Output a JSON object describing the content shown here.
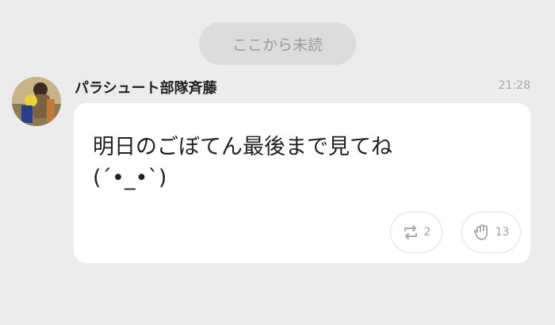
{
  "divider": {
    "unread_label": "ここから未読"
  },
  "message": {
    "sender_name": "パラシュート部隊斉藤",
    "time": "21:28",
    "text": "明日のごぼてん最後まで見てね\n(´•_•`)",
    "reactions": [
      {
        "icon": "repost-icon",
        "count": "2"
      },
      {
        "icon": "clap-icon",
        "count": "13"
      }
    ]
  },
  "colors": {
    "background": "#ececec",
    "bubble": "#ffffff",
    "pill": "#dcdcdc",
    "muted_text": "#a0a0a0"
  }
}
